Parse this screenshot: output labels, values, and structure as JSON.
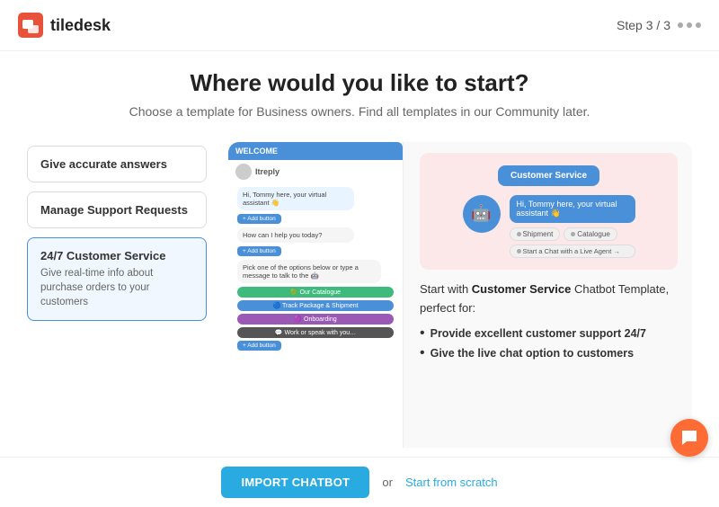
{
  "header": {
    "logo_text": "tiledesk",
    "step_text": "Step",
    "step_current": "3",
    "step_separator": "/",
    "step_total": "3"
  },
  "page": {
    "title": "Where would you like to start?",
    "subtitle": "Choose a template for Business owners. Find all templates in our Community later."
  },
  "options": [
    {
      "id": "give-accurate-answers",
      "label": "Give accurate answers",
      "desc": "",
      "active": false
    },
    {
      "id": "manage-support-requests",
      "label": "Manage Support Requests",
      "desc": "",
      "active": false
    },
    {
      "id": "customer-service",
      "label": "24/7 Customer Service",
      "desc": "Give real-time info about purchase orders to your customers",
      "active": true
    }
  ],
  "preview": {
    "mockup_header": "WELCOME",
    "mockup_brand": "Itreply",
    "chat_greeting": "Hi, Tommy here, your virtual assistant 👋",
    "chat_question": "How can I help you today?",
    "chat_pick": "Pick one of the options below or type a message to talk to the 🤖",
    "add_button": "+ Add button",
    "options_chat": [
      "🟢 Our Catalogue",
      "🔵 Track Package & Shipment",
      "🟣 Onboarding",
      "💬 Work or speak with you …",
      "+ Add button"
    ]
  },
  "illustration": {
    "cs_card_label": "Customer Service",
    "bubble_text": "Hi, Tommy here, your virtual assistant 👋",
    "pills": [
      "Shipment",
      "Catalogue"
    ],
    "live_agent_pill": "Start a Chat with a Live Agent →"
  },
  "description": {
    "text_prefix": "Start with ",
    "text_bold": "Customer Service",
    "text_suffix": " Chatbot Template, perfect for:",
    "bullets": [
      "Provide excellent customer support 24/7",
      "Give the live chat option to customers"
    ]
  },
  "footer": {
    "import_label": "IMPORT CHATBOT",
    "or_text": "or",
    "scratch_label": "Start from scratch"
  }
}
